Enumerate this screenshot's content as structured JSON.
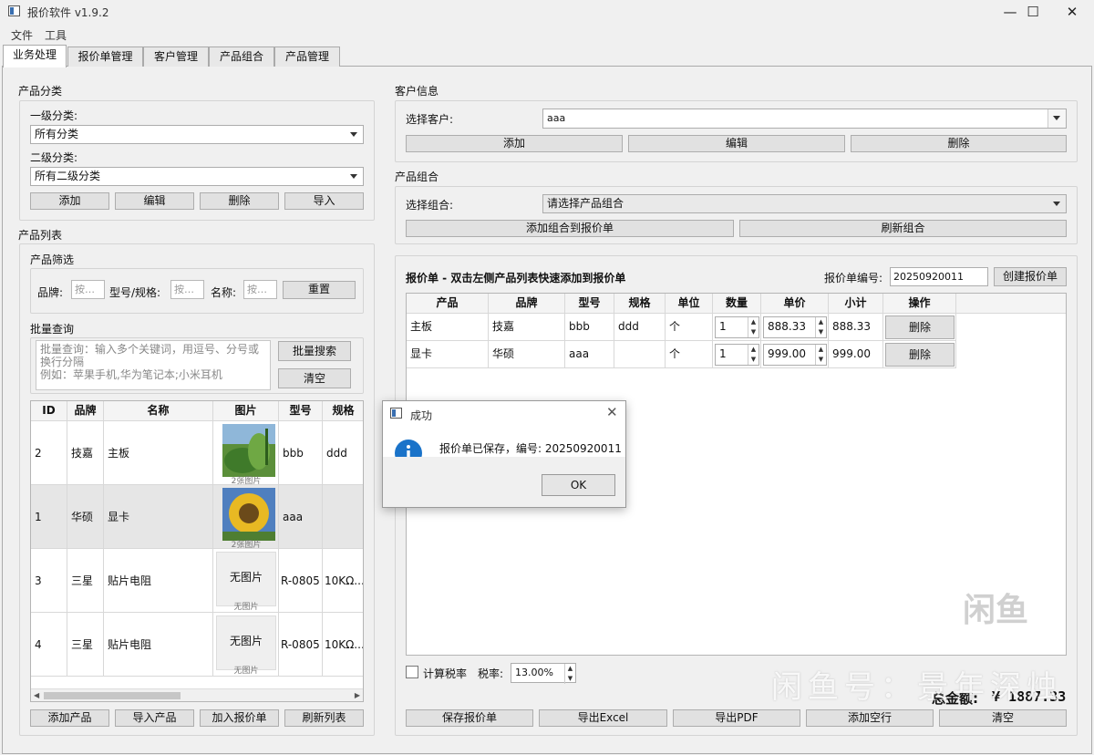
{
  "window": {
    "title": "报价软件 v1.9.2"
  },
  "menu": [
    "文件",
    "工具"
  ],
  "tabs": [
    "业务处理",
    "报价单管理",
    "客户管理",
    "产品组合",
    "产品管理"
  ],
  "category": {
    "group_title": "产品分类",
    "level1_label": "一级分类:",
    "level1_value": "所有分类",
    "level2_label": "二级分类:",
    "level2_value": "所有二级分类",
    "buttons": [
      "添加",
      "编辑",
      "删除",
      "导入"
    ]
  },
  "product_list": {
    "group_title": "产品列表",
    "filter_title": "产品筛选",
    "brand_label": "品牌:",
    "model_label": "型号/规格:",
    "name_label": "名称:",
    "placeholder": "按…",
    "reset_label": "重置",
    "batch_title": "批量查询",
    "batch_placeholder_1": "批量查询：输入多个关键词，用逗号、分号或换行分隔",
    "batch_placeholder_2": "例如：苹果手机,华为笔记本;小米耳机",
    "batch_search_label": "批量搜索",
    "clear_label": "清空",
    "columns": [
      "ID",
      "品牌",
      "名称",
      "图片",
      "型号",
      "规格"
    ],
    "rows": [
      {
        "id": "2",
        "brand": "技嘉",
        "name": "主板",
        "image": "photo",
        "image_caption": "2张图片",
        "model": "bbb",
        "spec": "ddd"
      },
      {
        "id": "1",
        "brand": "华硕",
        "name": "显卡",
        "image": "photo",
        "image_caption": "2张图片",
        "model": "aaa",
        "spec": ""
      },
      {
        "id": "3",
        "brand": "三星",
        "name": "贴片电阻",
        "image": "none",
        "image_text": "无图片",
        "image_caption": "无图片",
        "model": "R-0805",
        "spec": "10KΩ..."
      },
      {
        "id": "4",
        "brand": "三星",
        "name": "贴片电阻",
        "image": "none",
        "image_text": "无图片",
        "image_caption": "无图片",
        "model": "R-0805",
        "spec": "10KΩ..."
      }
    ],
    "bottom_buttons": [
      "添加产品",
      "导入产品",
      "加入报价单",
      "刷新列表"
    ]
  },
  "customer": {
    "group_title": "客户信息",
    "select_label": "选择客户:",
    "select_value": "aaa",
    "buttons": [
      "添加",
      "编辑",
      "删除"
    ]
  },
  "combo_group": {
    "group_title": "产品组合",
    "select_label": "选择组合:",
    "select_value": "请选择产品组合",
    "add_button": "添加组合到报价单",
    "refresh_button": "刷新组合"
  },
  "quote": {
    "header": "报价单 - 双击左侧产品列表快速添加到报价单",
    "number_label": "报价单编号:",
    "number_value": "20250920011",
    "create_button": "创建报价单",
    "columns": [
      "产品",
      "品牌",
      "型号",
      "规格",
      "单位",
      "数量",
      "单价",
      "小计",
      "操作"
    ],
    "rows": [
      {
        "product": "主板",
        "brand": "技嘉",
        "model": "bbb",
        "spec": "ddd",
        "unit": "个",
        "qty": "1",
        "price": "888.33",
        "subtotal": "888.33",
        "action": "删除"
      },
      {
        "product": "显卡",
        "brand": "华硕",
        "model": "aaa",
        "spec": "",
        "unit": "个",
        "qty": "1",
        "price": "999.00",
        "subtotal": "999.00",
        "action": "删除"
      }
    ],
    "tax_checkbox_label": "计算税率",
    "tax_rate_label": "税率:",
    "tax_rate_value": "13.00%",
    "total_label": "总金额:",
    "total_value": "¥ 1887.33",
    "bottom_buttons": [
      "保存报价单",
      "导出Excel",
      "导出PDF",
      "添加空行",
      "清空"
    ]
  },
  "dialog": {
    "title": "成功",
    "message": "报价单已保存，编号: 20250920011",
    "ok_label": "OK"
  },
  "watermark": {
    "logo": "闲鱼",
    "text": "闲鱼号：景年深烛"
  },
  "colors": {
    "info_icon": "#1a73c9",
    "window_bg": "#f0f0f0",
    "button_bg": "#e1e1e1"
  }
}
